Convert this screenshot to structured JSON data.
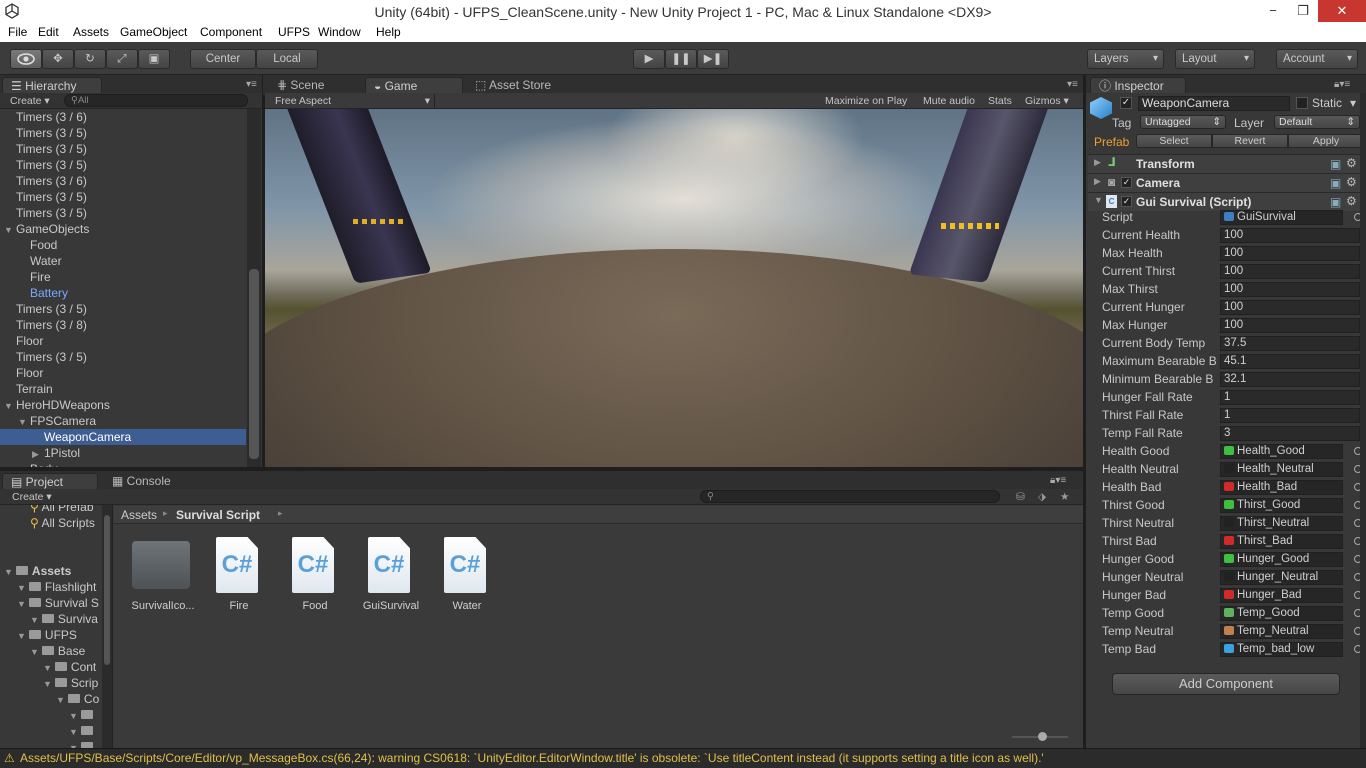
{
  "window": {
    "title": "Unity (64bit) - UFPS_CleanScene.unity - New Unity Project 1 - PC, Mac & Linux Standalone <DX9>",
    "minimize": "−",
    "maximize": "❐",
    "close": "✕"
  },
  "menu": [
    "File",
    "Edit",
    "Assets",
    "GameObject",
    "Component",
    "UFPS",
    "Window",
    "Help"
  ],
  "toolbar": {
    "center": "Center",
    "local": "Local",
    "layers": "Layers",
    "layout": "Layout",
    "account": "Account"
  },
  "hierarchy": {
    "tab": "Hierarchy",
    "create": "Create",
    "search_placeholder": "All",
    "rows": [
      {
        "label": "Timers (3 / 6)",
        "indent": 0
      },
      {
        "label": "Timers (3 / 5)",
        "indent": 0
      },
      {
        "label": "Timers (3 / 5)",
        "indent": 0
      },
      {
        "label": "Timers (3 / 5)",
        "indent": 0
      },
      {
        "label": "Timers (3 / 6)",
        "indent": 0
      },
      {
        "label": "Timers (3 / 5)",
        "indent": 0
      },
      {
        "label": "Timers (3 / 5)",
        "indent": 0
      },
      {
        "label": "GameObjects",
        "indent": 0,
        "arrow": "▼"
      },
      {
        "label": "Food",
        "indent": 1
      },
      {
        "label": "Water",
        "indent": 1
      },
      {
        "label": "Fire",
        "indent": 1
      },
      {
        "label": "Battery",
        "indent": 1,
        "blue": true
      },
      {
        "label": "Timers (3 / 5)",
        "indent": 0
      },
      {
        "label": "Timers (3 / 8)",
        "indent": 0
      },
      {
        "label": "Floor",
        "indent": 0
      },
      {
        "label": "Timers (3 / 5)",
        "indent": 0
      },
      {
        "label": "Floor",
        "indent": 0
      },
      {
        "label": "Terrain",
        "indent": 0
      },
      {
        "label": "HeroHDWeapons",
        "indent": 0,
        "arrow": "▼"
      },
      {
        "label": "FPSCamera",
        "indent": 1,
        "arrow": "▼"
      },
      {
        "label": "WeaponCamera",
        "indent": 2,
        "selected": true
      },
      {
        "label": "1Pistol",
        "indent": 2,
        "arrow": "▶"
      },
      {
        "label": "Body",
        "indent": 1,
        "arrow": "▶"
      }
    ]
  },
  "scene_tabs": {
    "scene": "Scene",
    "game": "Game",
    "asset_store": "Asset Store"
  },
  "game_bar": {
    "aspect": "Free Aspect",
    "maximize": "Maximize on Play",
    "mute": "Mute audio",
    "stats": "Stats",
    "gizmos": "Gizmos"
  },
  "project": {
    "tab": "Project",
    "console_tab": "Console",
    "create": "Create",
    "breadcrumb": [
      "Assets",
      "Survival Script"
    ],
    "favorites": [
      "All Prefab",
      "All Scripts"
    ],
    "tree": [
      {
        "label": "Assets",
        "indent": 0,
        "bold": true
      },
      {
        "label": "Flashlight",
        "indent": 1
      },
      {
        "label": "Survival S",
        "indent": 1
      },
      {
        "label": "Surviva",
        "indent": 2
      },
      {
        "label": "UFPS",
        "indent": 1
      },
      {
        "label": "Base",
        "indent": 2
      },
      {
        "label": "Cont",
        "indent": 3
      },
      {
        "label": "Scrip",
        "indent": 3
      },
      {
        "label": "Co",
        "indent": 4
      },
      {
        "label": "",
        "indent": 5
      },
      {
        "label": "",
        "indent": 5
      },
      {
        "label": "",
        "indent": 5
      }
    ],
    "items": [
      {
        "name": "SurvivalIco...",
        "kind": "folder"
      },
      {
        "name": "Fire",
        "kind": "cs"
      },
      {
        "name": "Food",
        "kind": "cs"
      },
      {
        "name": "GuiSurvival",
        "kind": "cs"
      },
      {
        "name": "Water",
        "kind": "cs"
      }
    ]
  },
  "inspector": {
    "tab": "Inspector",
    "object_name": "WeaponCamera",
    "static": "Static",
    "tag_label": "Tag",
    "tag": "Untagged",
    "layer_label": "Layer",
    "layer": "Default",
    "prefab": "Prefab",
    "select": "Select",
    "revert": "Revert",
    "apply": "Apply",
    "components": [
      "Transform",
      "Camera",
      "Gui Survival (Script)"
    ],
    "fields": [
      {
        "label": "Script",
        "value": "GuiSurvival",
        "obj": true,
        "swatch": "#3d7fc0"
      },
      {
        "label": "Current Health",
        "value": "100"
      },
      {
        "label": "Max Health",
        "value": "100"
      },
      {
        "label": "Current Thirst",
        "value": "100"
      },
      {
        "label": "Max Thirst",
        "value": "100"
      },
      {
        "label": "Current Hunger",
        "value": "100"
      },
      {
        "label": "Max Hunger",
        "value": "100"
      },
      {
        "label": "Current Body Temp",
        "value": "37.5"
      },
      {
        "label": "Maximum Bearable B",
        "value": "45.1"
      },
      {
        "label": "Minimum Bearable B",
        "value": "32.1"
      },
      {
        "label": "Hunger Fall Rate",
        "value": "1"
      },
      {
        "label": "Thirst Fall Rate",
        "value": "1"
      },
      {
        "label": "Temp Fall Rate",
        "value": "3"
      },
      {
        "label": "Health Good",
        "value": "Health_Good",
        "obj": true,
        "swatch": "#3fbf3f"
      },
      {
        "label": "Health Neutral",
        "value": "Health_Neutral",
        "obj": true,
        "swatch": "#222222"
      },
      {
        "label": "Health Bad",
        "value": "Health_Bad",
        "obj": true,
        "swatch": "#d02a2a"
      },
      {
        "label": "Thirst Good",
        "value": "Thirst_Good",
        "obj": true,
        "swatch": "#3fbf3f"
      },
      {
        "label": "Thirst Neutral",
        "value": "Thirst_Neutral",
        "obj": true,
        "swatch": "#222222"
      },
      {
        "label": "Thirst Bad",
        "value": "Thirst_Bad",
        "obj": true,
        "swatch": "#d02a2a"
      },
      {
        "label": "Hunger Good",
        "value": "Hunger_Good",
        "obj": true,
        "swatch": "#3fbf3f"
      },
      {
        "label": "Hunger Neutral",
        "value": "Hunger_Neutral",
        "obj": true,
        "swatch": "#222222"
      },
      {
        "label": "Hunger Bad",
        "value": "Hunger_Bad",
        "obj": true,
        "swatch": "#d02a2a"
      },
      {
        "label": "Temp Good",
        "value": "Temp_Good",
        "obj": true,
        "swatch": "#5fb05f"
      },
      {
        "label": "Temp Neutral",
        "value": "Temp_Neutral",
        "obj": true,
        "swatch": "#c08050"
      },
      {
        "label": "Temp Bad",
        "value": "Temp_bad_low",
        "obj": true,
        "swatch": "#3aa0e0"
      }
    ],
    "add_component": "Add Component"
  },
  "status": {
    "message": "Assets/UFPS/Base/Scripts/Core/Editor/vp_MessageBox.cs(66,24): warning CS0618: `UnityEditor.EditorWindow.title' is obsolete: `Use titleContent instead (it supports setting a title icon as well).'"
  }
}
